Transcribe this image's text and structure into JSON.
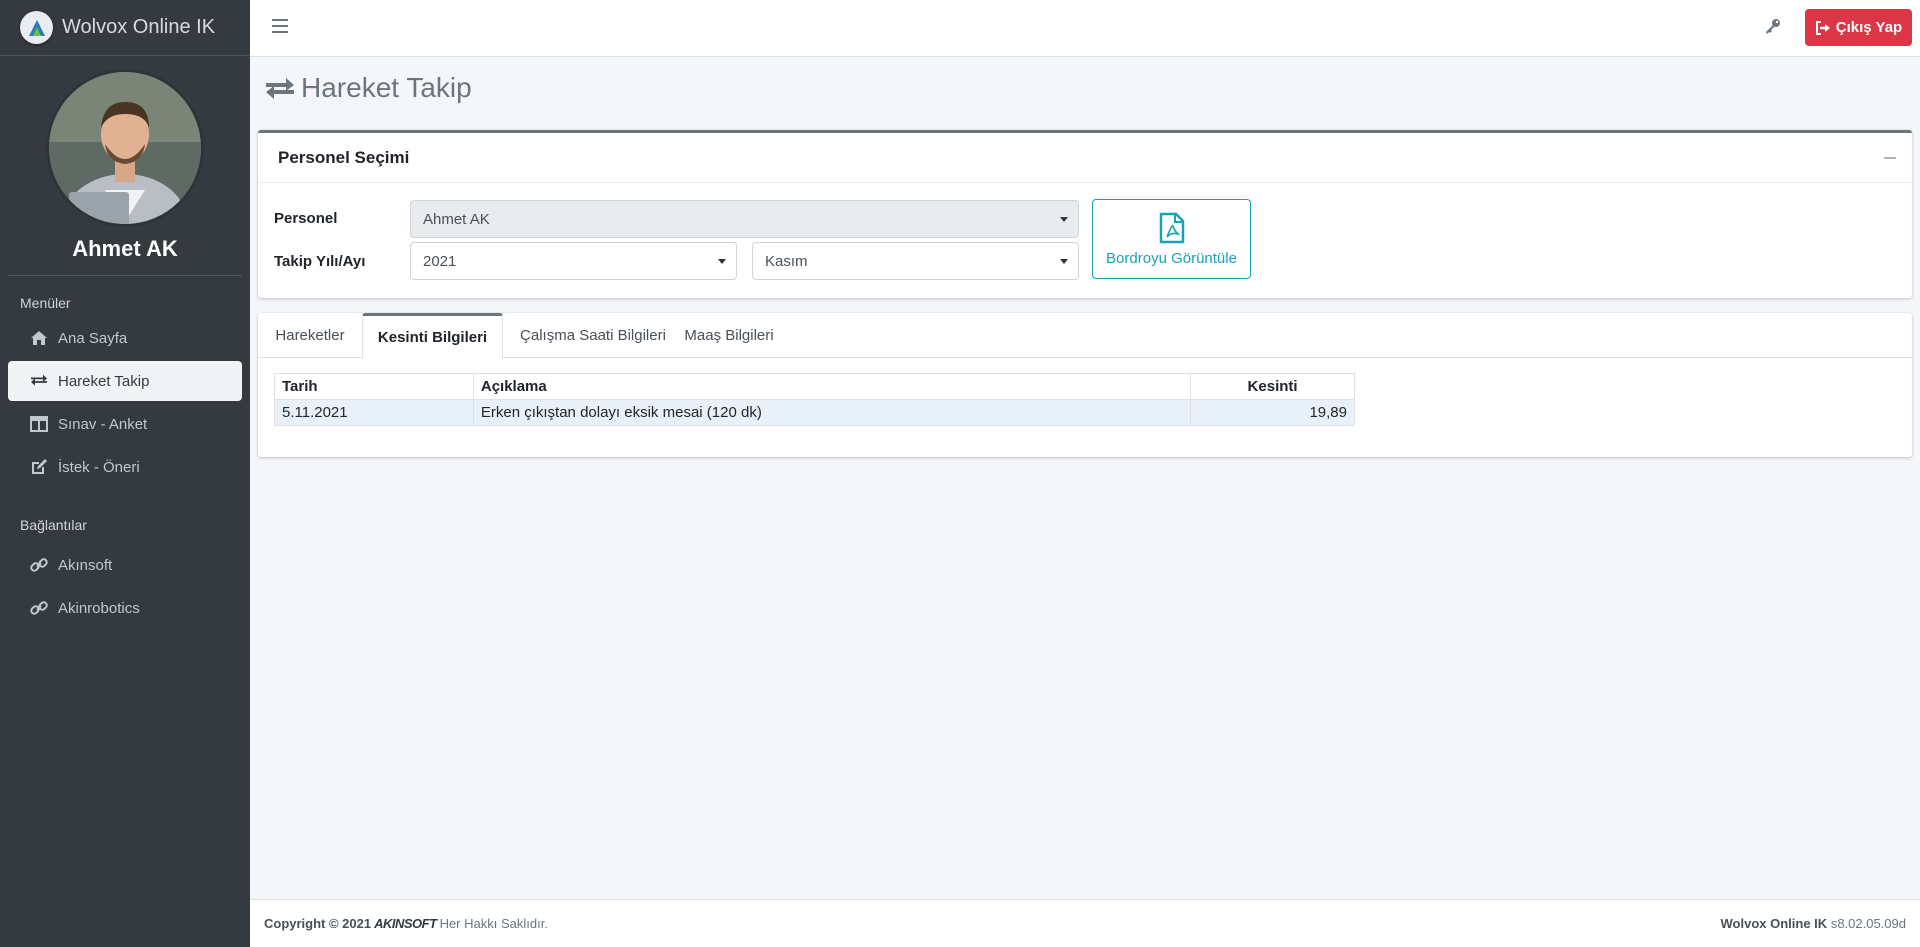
{
  "app": {
    "title": "Wolvox Online IK"
  },
  "user": {
    "name": "Ahmet AK"
  },
  "sidebar": {
    "menu_header": "Menüler",
    "menu_items": [
      {
        "label": "Ana Sayfa",
        "icon": "home-icon"
      },
      {
        "label": "Hareket Takip",
        "icon": "exchange-icon",
        "active": true
      },
      {
        "label": "Sınav - Anket",
        "icon": "columns-icon"
      },
      {
        "label": "İstek - Öneri",
        "icon": "edit-icon"
      }
    ],
    "links_header": "Bağlantılar",
    "link_items": [
      {
        "label": "Akınsoft",
        "icon": "link-icon"
      },
      {
        "label": "Akinrobotics",
        "icon": "link-icon"
      }
    ]
  },
  "topbar": {
    "logout_label": "Çıkış Yap"
  },
  "page": {
    "title": "Hareket Takip"
  },
  "selection": {
    "title": "Personel Seçimi",
    "personel_label": "Personel",
    "personel_value": "Ahmet AK",
    "period_label": "Takip Yılı/Ayı",
    "year_value": "2021",
    "month_value": "Kasım",
    "payroll_button": "Bordroyu Görüntüle"
  },
  "tabs": [
    {
      "label": "Hareketler"
    },
    {
      "label": "Kesinti Bilgileri",
      "active": true
    },
    {
      "label": "Çalışma Saati Bilgileri"
    },
    {
      "label": "Maaş Bilgileri"
    }
  ],
  "table": {
    "headers": {
      "date": "Tarih",
      "description": "Açıklama",
      "amount": "Kesinti"
    },
    "rows": [
      {
        "date": "5.11.2021",
        "description": "Erken çıkıştan dolayı eksik mesai (120 dk)",
        "amount": "19,89"
      }
    ]
  },
  "footer": {
    "copyright": "Copyright © 2021",
    "brand": "AKINSOFT",
    "rights": "Her Hakkı Saklıdır.",
    "app_name": "Wolvox Online IK",
    "version": "s8.02.05.09d"
  },
  "colors": {
    "sidebar": "#343a40",
    "danger": "#dc3545",
    "info": "#17a2b8",
    "row_highlight": "#e8f1f9"
  }
}
